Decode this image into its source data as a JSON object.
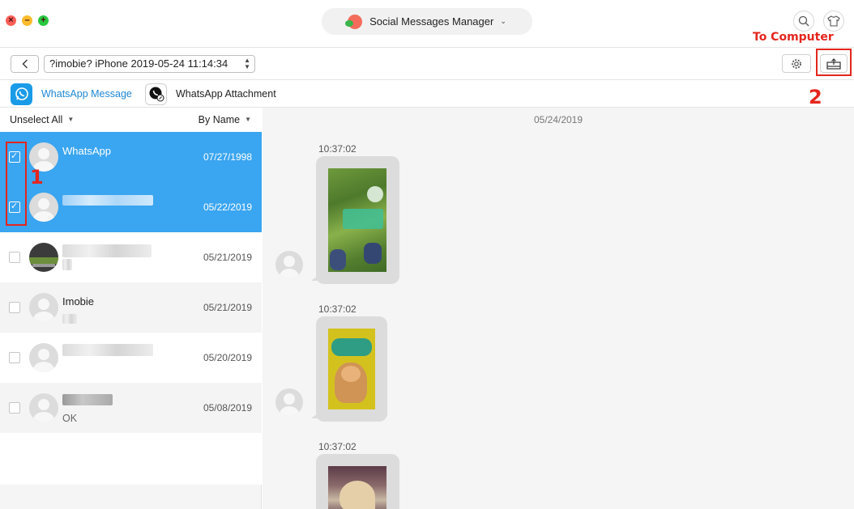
{
  "window": {
    "app_title": "Social Messages Manager",
    "accent_color": "#1e88d6",
    "selection_color": "#3aa5f0",
    "annotation_color": "#e3261e"
  },
  "toolbar": {
    "device_label": "?imobie? iPhone  2019-05-24 11:14:34",
    "back_icon": "chevron-left-icon",
    "settings_icon": "gear-icon",
    "export_icon": "export-to-computer-icon"
  },
  "tabs": [
    {
      "label": "WhatsApp Message",
      "active": true
    },
    {
      "label": "WhatsApp Attachment",
      "active": false
    }
  ],
  "list_header": {
    "unselect_all": "Unselect All",
    "sort": "By Name"
  },
  "contacts": [
    {
      "name": "WhatsApp",
      "preview": "",
      "date": "07/27/1998",
      "checked": true
    },
    {
      "name": "",
      "preview": "",
      "date": "05/22/2019",
      "checked": true
    },
    {
      "name": "",
      "preview": "",
      "date": "05/21/2019",
      "checked": false
    },
    {
      "name": "Imobie",
      "preview": "",
      "date": "05/21/2019",
      "checked": false
    },
    {
      "name": "",
      "preview": "",
      "date": "05/20/2019",
      "checked": false
    },
    {
      "name": "",
      "preview": "OK",
      "date": "05/08/2019",
      "checked": false
    }
  ],
  "conversation": {
    "date": "05/24/2019",
    "messages": [
      {
        "time": "10:37:02",
        "type": "image"
      },
      {
        "time": "10:37:02",
        "type": "image"
      },
      {
        "time": "10:37:02",
        "type": "image"
      }
    ]
  },
  "annotations": {
    "step1": "1",
    "step2": "2",
    "export_hint": "To Computer"
  }
}
